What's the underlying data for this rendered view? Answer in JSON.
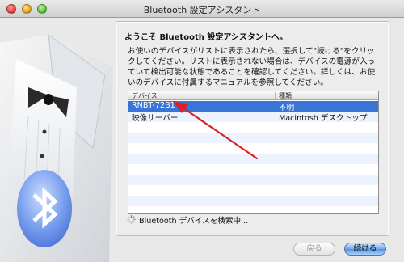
{
  "window": {
    "title": "Bluetooth 設定アシスタント"
  },
  "panel": {
    "heading": "ようこそ Bluetooth 設定アシスタントへ。",
    "instructions": "お使いのデバイスがリストに表示されたら、選択して\"続ける\"をクリックしてください。リストに表示されない場合は、デバイスの電源が入っていて検出可能な状態であることを確認してください。詳しくは、お使いのデバイスに付属するマニュアルを参照してください。"
  },
  "device_table": {
    "columns": [
      "デバイス",
      "種類"
    ],
    "rows": [
      {
        "device": "RNBT-72B1",
        "type": "不明",
        "selected": true
      },
      {
        "device": "映像サーバー",
        "type": "Macintosh デスクトップ",
        "selected": false
      }
    ],
    "empty_rows": 9
  },
  "status": {
    "text": "Bluetooth デバイスを検索中..."
  },
  "buttons": {
    "back": "戻る",
    "continue": "続ける"
  },
  "colors": {
    "selection": "#3875d7",
    "annotation_arrow": "#e02020",
    "default_button": "#5b9ae6"
  }
}
